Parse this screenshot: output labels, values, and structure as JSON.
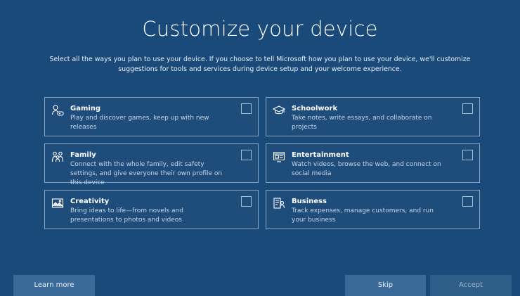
{
  "page": {
    "title": "Customize your device",
    "subtitle": "Select all the ways you plan to use your device. If you choose to tell Microsoft how you plan to use your device, we'll customize suggestions for tools and services during device setup and your welcome experience."
  },
  "options": [
    {
      "name": "Gaming",
      "desc": "Play and discover games, keep up with new releases",
      "icon": "gaming-icon",
      "checked": false
    },
    {
      "name": "Schoolwork",
      "desc": "Take notes, write essays, and collaborate on projects",
      "icon": "graduation-cap-icon",
      "checked": false
    },
    {
      "name": "Family",
      "desc": "Connect with the whole family, edit safety settings, and give everyone their own profile on this device",
      "icon": "family-icon",
      "checked": false
    },
    {
      "name": "Entertainment",
      "desc": "Watch videos, browse the web, and connect on social media",
      "icon": "entertainment-icon",
      "checked": false
    },
    {
      "name": "Creativity",
      "desc": "Bring ideas to life—from novels and presentations to photos and videos",
      "icon": "picture-icon",
      "checked": false
    },
    {
      "name": "Business",
      "desc": "Track expenses, manage customers, and run your business",
      "icon": "business-icon",
      "checked": false
    }
  ],
  "buttons": {
    "learn_more": "Learn more",
    "skip": "Skip",
    "accept": "Accept"
  },
  "colors": {
    "background": "#1a4a7a",
    "card_border": "#8aa6c1",
    "button": "#3a6a98",
    "button_disabled": "#2e5d8a"
  }
}
